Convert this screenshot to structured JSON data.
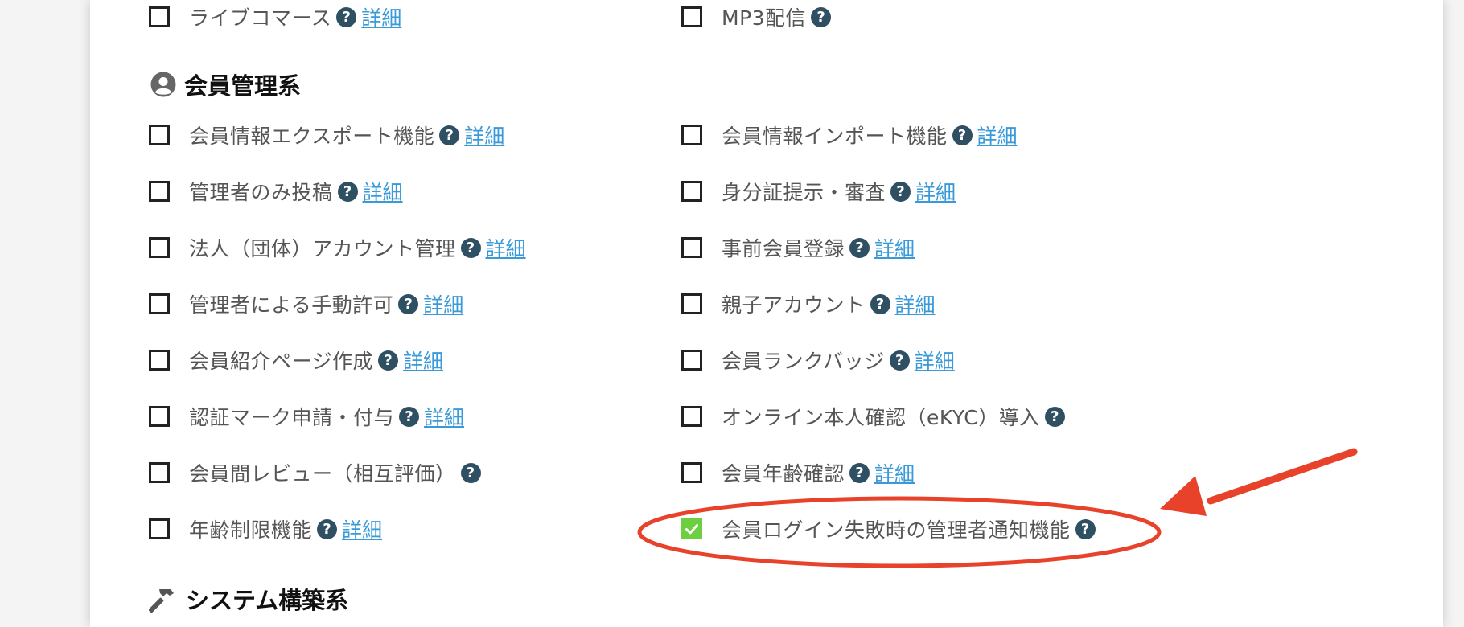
{
  "top_row": {
    "left": {
      "label": "ライブコマース",
      "help": "?",
      "detail": "詳細"
    },
    "right": {
      "label": "MP3配信",
      "help": "?"
    }
  },
  "member_section": {
    "title": "会員管理系",
    "icon": "user-circle-icon",
    "left_items": [
      {
        "label": "会員情報エクスポート機能",
        "help": "?",
        "detail": "詳細"
      },
      {
        "label": "管理者のみ投稿",
        "help": "?",
        "detail": "詳細"
      },
      {
        "label": "法人（団体）アカウント管理",
        "help": "?",
        "detail": "詳細"
      },
      {
        "label": "管理者による手動許可",
        "help": "?",
        "detail": "詳細"
      },
      {
        "label": "会員紹介ページ作成",
        "help": "?",
        "detail": "詳細"
      },
      {
        "label": "認証マーク申請・付与",
        "help": "?",
        "detail": "詳細"
      },
      {
        "label": "会員間レビュー（相互評価）",
        "help": "?"
      },
      {
        "label": "年齢制限機能",
        "help": "?",
        "detail": "詳細"
      }
    ],
    "right_items": [
      {
        "label": "会員情報インポート機能",
        "help": "?",
        "detail": "詳細"
      },
      {
        "label": "身分証提示・審査",
        "help": "?",
        "detail": "詳細"
      },
      {
        "label": "事前会員登録",
        "help": "?",
        "detail": "詳細"
      },
      {
        "label": "親子アカウント",
        "help": "?",
        "detail": "詳細"
      },
      {
        "label": "会員ランクバッジ",
        "help": "?",
        "detail": "詳細"
      },
      {
        "label": "オンライン本人確認（eKYC）導入",
        "help": "?"
      },
      {
        "label": "会員年齢確認",
        "help": "?",
        "detail": "詳細"
      },
      {
        "label": "会員ログイン失敗時の管理者通知機能",
        "help": "?",
        "checked": true
      }
    ]
  },
  "system_section": {
    "title": "システム構築系",
    "icon": "hammer-icon"
  },
  "colors": {
    "checkbox_checked": "#6ccf3f",
    "help_icon": "#2f4f63",
    "link": "#3a9ad9",
    "annotation": "#e8432a"
  }
}
